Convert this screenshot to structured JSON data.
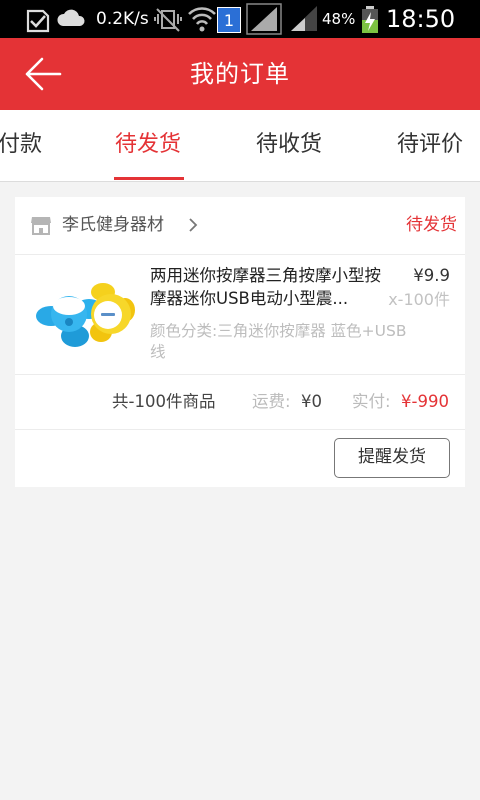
{
  "status_bar": {
    "network_speed": "0.2K/s",
    "sim_slot": "1",
    "battery_percent": "48%",
    "time": "18:50",
    "icons": [
      "notification-check-icon",
      "cloud-icon",
      "vibrate-off-icon",
      "wifi-icon",
      "sim-badge-icon",
      "signal-icon",
      "signal-icon",
      "battery-charging-icon"
    ]
  },
  "header": {
    "title": "我的订单",
    "back_icon": "back-arrow-icon",
    "color": "#e43336"
  },
  "tabs": [
    {
      "label": "付款",
      "active": false
    },
    {
      "label": "待发货",
      "active": true
    },
    {
      "label": "待收货",
      "active": false
    },
    {
      "label": "待评价",
      "active": false
    }
  ],
  "order": {
    "shop_name": "李氏健身器材",
    "shop_icon": "store-icon",
    "status": "待发货",
    "item": {
      "name": "两用迷你按摩器三角按摩小型按摩器迷你USB电动小型震...",
      "price": "¥9.9",
      "quantity": "x-100件",
      "spec": "颜色分类:三角迷你按摩器 蓝色+USB线"
    },
    "summary": {
      "count_text": "共-100件商品",
      "shipping_label": "运费:",
      "shipping_value": "¥0",
      "paid_label": "实付:",
      "paid_value": "¥-990"
    },
    "remind_button": "提醒发货"
  },
  "colors": {
    "accent": "#e43336",
    "background": "#f3f3f3"
  }
}
